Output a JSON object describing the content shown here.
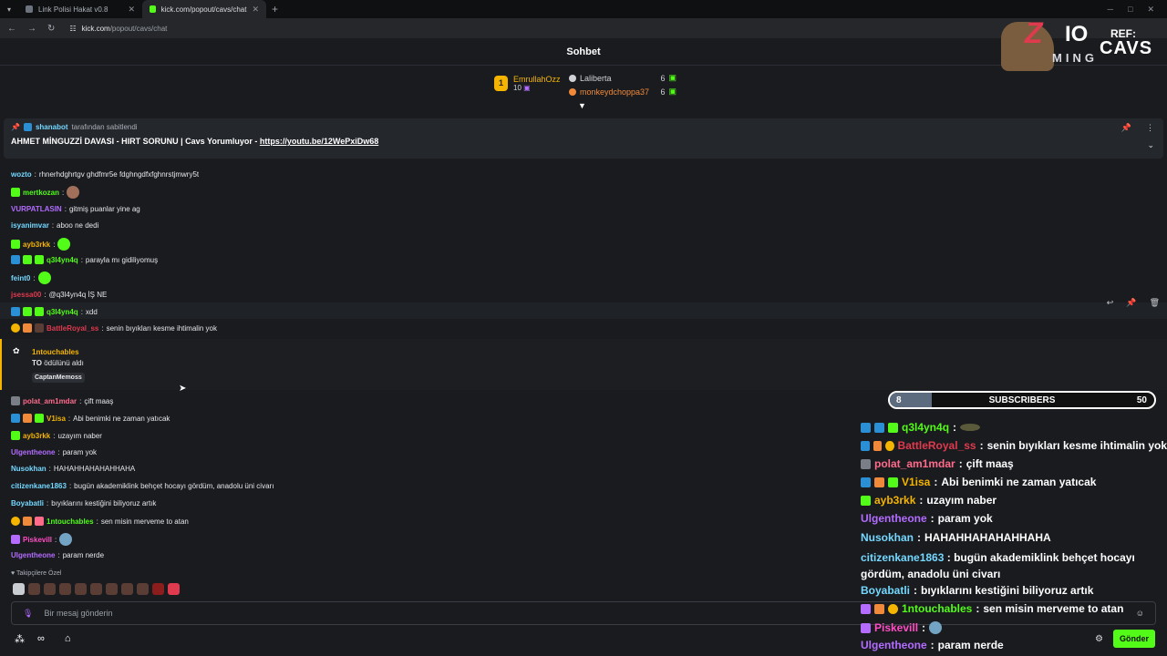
{
  "browser": {
    "tabs": [
      {
        "title": "Link Polisi Hakat v0.8",
        "active": false
      },
      {
        "title": "kick.com/popout/cavs/chat",
        "active": true
      }
    ],
    "url_host": "kick.com",
    "url_path": "/popout/cavs/chat"
  },
  "chat": {
    "title": "Sohbet",
    "top_gifters": [
      {
        "rank": "1",
        "name": "EmrullahOzz",
        "count": "10"
      },
      {
        "name": "Laliberta",
        "count": "6"
      },
      {
        "name": "monkeydchoppa37",
        "count": "6"
      }
    ],
    "pinned": {
      "by": "shanabot",
      "by_suffix": "tarafından sabitlendi",
      "text": "AHMET MİNGUZZİ DAVASI - HIRT SORUNU | Cavs Yorumluyor - ",
      "link": "https://youtu.be/12WePxiDw68"
    },
    "messages": [
      {
        "user": "wozto",
        "text": "rhnerhdghrtgv ghdfmr5e fdghngdfxfghnrstjmwry5t",
        "color": "#74d8ff"
      },
      {
        "user": "mertkozan",
        "text": "",
        "color": "#53fc18"
      },
      {
        "user": "VURPATLASIN",
        "text": "gitmiş puanlar yine ag",
        "color": "#b36cff"
      },
      {
        "user": "isyanimvar",
        "text": "aboo ne dedi",
        "color": "#74d8ff"
      },
      {
        "user": "ayb3rkk",
        "text": "",
        "color": "#f5b400"
      },
      {
        "user": "q3l4yn4q",
        "text": "parayla mı gidiliyomuş",
        "color": "#53fc18"
      },
      {
        "user": "feint0",
        "text": "",
        "color": "#74d8ff"
      },
      {
        "user": "jsessa00",
        "text": "@q3l4yn4q İŞ NE",
        "color": "#e03a4e"
      },
      {
        "user": "q3l4yn4q",
        "text": "xdd",
        "color": "#53fc18"
      },
      {
        "user": "BattleRoyal_ss",
        "text": "senin bıyıkları kesme ihtimalin yok",
        "color": "#e03a4e"
      },
      {
        "user": "polat_am1mdar",
        "text": "çift maaş",
        "color": "#ff6b8b"
      },
      {
        "user": "V1isa",
        "text": "Abi benimki ne zaman yatıcak",
        "color": "#f5b400"
      },
      {
        "user": "ayb3rkk",
        "text": "uzayım naber",
        "color": "#f5b400"
      },
      {
        "user": "Ulgentheone",
        "text": "param yok",
        "color": "#b36cff"
      },
      {
        "user": "Nusokhan",
        "text": "HAHAHHAHAHAHHAHA",
        "color": "#74d8ff"
      },
      {
        "user": "citizenkane1863",
        "text": "bugün akademiklink behçet hocayı gördüm, anadolu üni civarı",
        "color": "#74d8ff"
      },
      {
        "user": "Boyabatli",
        "text": "bıyıklarını kestiğini biliyoruz artık",
        "color": "#74d8ff"
      },
      {
        "user": "1ntouchables",
        "text": "sen misin merveme to atan",
        "color": "#53fc18"
      },
      {
        "user": "Piskevill",
        "text": "",
        "color": "#ff4dc4"
      },
      {
        "user": "Ulgentheone",
        "text": "param nerde",
        "color": "#b36cff"
      }
    ],
    "reward": {
      "user": "1ntouchables",
      "bold": "TO",
      "text": "ödülünü aldı",
      "target": "CaptanMemoss"
    },
    "followers_only_label": "Takipçilere Özel",
    "input_placeholder": "Bir mesaj gönderin",
    "send_label": "Gönder"
  },
  "overlay": {
    "logo_z": "Z",
    "logo_io": "IO",
    "logo_ming": "MING",
    "ref_label": "REF:",
    "ref_name": "CAVS",
    "subs": {
      "current": 8,
      "goal": 50,
      "label": "SUBSCRIBERS"
    },
    "messages": [
      {
        "user": "q3l4yn4q",
        "text": "",
        "color": "#53fc18"
      },
      {
        "user": "BattleRoyal_ss",
        "text": "senin bıyıkları kesme ihtimalin yok",
        "color": "#e03a4e"
      },
      {
        "user": "polat_am1mdar",
        "text": "çift maaş",
        "color": "#ff6b8b"
      },
      {
        "user": "V1isa",
        "text": "Abi benimki ne zaman yatıcak",
        "color": "#f5b400"
      },
      {
        "user": "ayb3rkk",
        "text": "uzayım naber",
        "color": "#f5b400"
      },
      {
        "user": "Ulgentheone",
        "text": "param yok",
        "color": "#b36cff"
      },
      {
        "user": "Nusokhan",
        "text": "HAHAHHAHAHAHHAHA",
        "color": "#74d8ff"
      },
      {
        "user": "citizenkane1863",
        "text": "bugün akademiklink behçet hocayı gördüm, anadolu üni civarı",
        "color": "#74d8ff"
      },
      {
        "user": "Boyabatli",
        "text": "bıyıklarını kestiğini biliyoruz artık",
        "color": "#74d8ff"
      },
      {
        "user": "1ntouchables",
        "text": "sen misin merveme to atan",
        "color": "#53fc18"
      },
      {
        "user": "Piskevill",
        "text": "",
        "color": "#ff4dc4"
      },
      {
        "user": "Ulgentheone",
        "text": "param nerde",
        "color": "#b36cff"
      }
    ]
  }
}
